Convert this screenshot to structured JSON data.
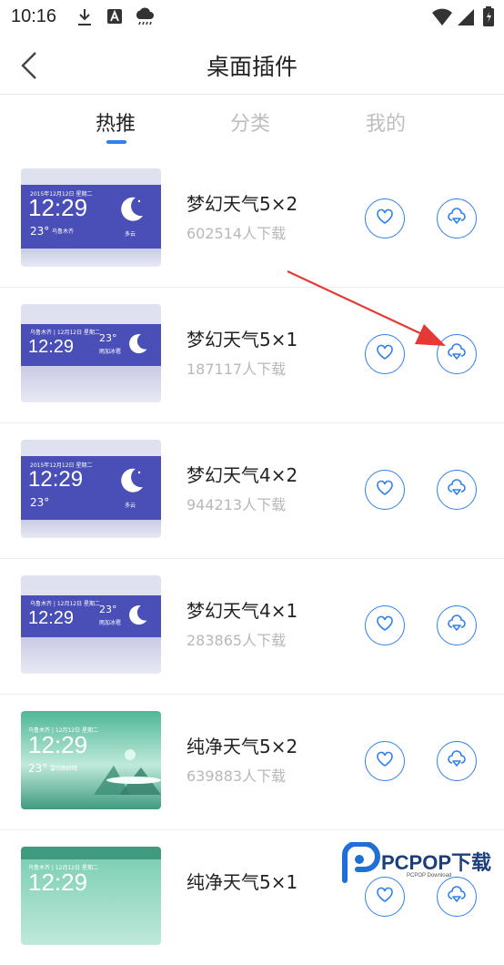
{
  "status_bar": {
    "time": "10:16"
  },
  "header": {
    "title": "桌面插件"
  },
  "tabs": [
    {
      "label": "热推",
      "active": true
    },
    {
      "label": "分类",
      "active": false
    },
    {
      "label": "我的",
      "active": false
    }
  ],
  "widgets": [
    {
      "name": "梦幻天气5×2",
      "downloads": "602514人下载",
      "thumb": {
        "style": "dream",
        "size": "5x2",
        "date": "2015年12月12日 星期二",
        "time": "12:29",
        "temp": "23°",
        "city": "乌鲁木齐",
        "weather": "多云"
      }
    },
    {
      "name": "梦幻天气5×1",
      "downloads": "187117人下载",
      "thumb": {
        "style": "dream",
        "size": "5x1",
        "date": "乌鲁木齐 | 12月12日 星期二",
        "time": "12:29",
        "temp": "23°",
        "weather": "雨加冰雹"
      }
    },
    {
      "name": "梦幻天气4×2",
      "downloads": "944213人下载",
      "thumb": {
        "style": "dream",
        "size": "4x2",
        "date": "2015年12月12日 星期二",
        "time": "12:29",
        "temp": "23°",
        "weather": "多云"
      }
    },
    {
      "name": "梦幻天气4×1",
      "downloads": "283865人下载",
      "thumb": {
        "style": "dream",
        "size": "4x1",
        "date": "乌鲁木齐 | 12月12日 星期二",
        "time": "12:29",
        "temp": "23°",
        "weather": "雨加冰雹"
      }
    },
    {
      "name": "纯净天气5×2",
      "downloads": "639883人下载",
      "thumb": {
        "style": "pure",
        "size": "5x2",
        "date": "乌鲁木齐 | 12月12日 星期二",
        "time": "12:29",
        "temp": "23°",
        "weather": "雷阵雨转晴"
      }
    },
    {
      "name": "纯净天气5×1",
      "downloads": "",
      "thumb": {
        "style": "pure",
        "size": "5x1",
        "date": "乌鲁木齐 | 12月12日 星期二",
        "time": "12:29",
        "temp": "",
        "weather": ""
      }
    }
  ],
  "watermark": {
    "brand": "PCPOP下载",
    "sub": "PCPOP Download"
  },
  "colors": {
    "accent": "#2f80ed",
    "annotation": "#e53935",
    "dream_top": "#4a4fb8",
    "pure_top": "#3f9a80"
  },
  "icons": [
    "download-icon",
    "font-a-icon",
    "rain-cloud-icon",
    "wifi-icon",
    "signal-icon",
    "battery-icon",
    "back-icon",
    "heart-icon",
    "cloud-download-icon"
  ]
}
